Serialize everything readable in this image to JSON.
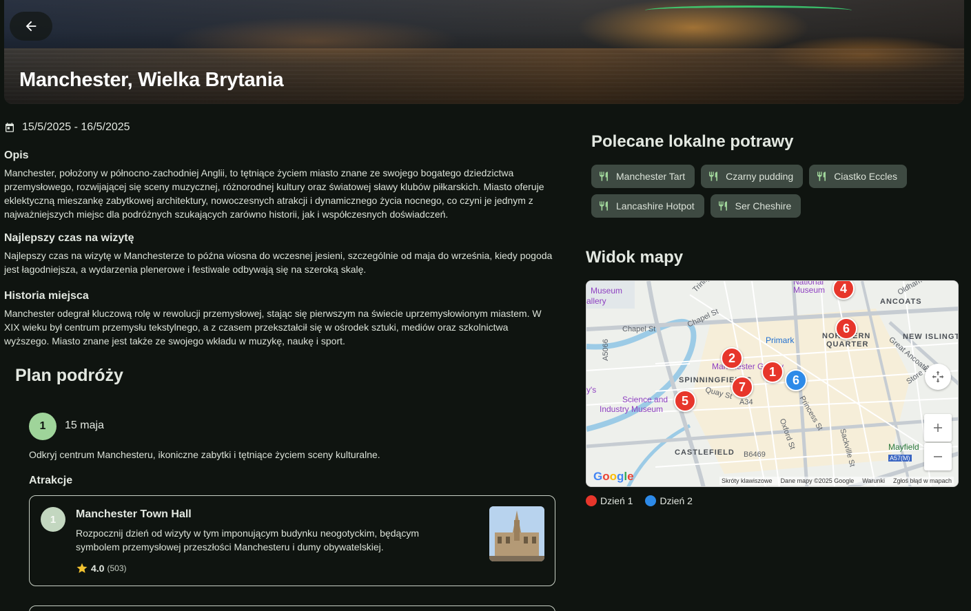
{
  "header": {
    "title": "Manchester, Wielka Brytania"
  },
  "dates": "15/5/2025 - 16/5/2025",
  "sections": {
    "opis": {
      "heading": "Opis",
      "text": "Manchester, położony w północno-zachodniej Anglii, to tętniące życiem miasto znane ze swojego bogatego dziedzictwa przemysłowego, rozwijającej się sceny muzycznej, różnorodnej kultury oraz światowej sławy klubów piłkarskich. Miasto oferuje eklektyczną mieszankę zabytkowej architektury, nowoczesnych atrakcji i dynamicznego życia nocnego, co czyni je jednym z najważniejszych miejsc dla podróżnych szukających zarówno historii, jak i współczesnych doświadczeń."
    },
    "best_time": {
      "heading": "Najlepszy czas na wizytę",
      "text": "Najlepszy czas na wizytę w Manchesterze to późna wiosna do wczesnej jesieni, szczególnie od maja do września, kiedy pogoda jest łagodniejsza, a wydarzenia plenerowe i festiwale odbywają się na szeroką skalę."
    },
    "history": {
      "heading": "Historia miejsca",
      "text": "Manchester odegrał kluczową rolę w rewolucji przemysłowej, stając się pierwszym na świecie uprzemysłowionym miastem. W XIX wieku był centrum przemysłu tekstylnego, a z czasem przekształcił się w ośrodek sztuki, mediów oraz szkolnictwa wyższego. Miasto znane jest także ze swojego wkładu w muzykę, naukę i sport."
    }
  },
  "plan": {
    "title": "Plan podróży",
    "day": {
      "number": "1",
      "label": "15 maja",
      "description": "Odkryj centrum Manchesteru, ikoniczne zabytki i tętniące życiem sceny kulturalne.",
      "attractions_heading": "Atrakcje",
      "attraction": {
        "number": "1",
        "name": "Manchester Town Hall",
        "description": "Rozpocznij dzień od wizyty w tym imponującym budynku neogotyckim, będącym symbolem przemysłowej przeszłości Manchesteru i dumy obywatelskiej.",
        "rating": "4.0",
        "reviews": "(503)"
      }
    }
  },
  "food": {
    "title": "Polecane lokalne potrawy",
    "items": [
      "Manchester Tart",
      "Czarny pudding",
      "Ciastko Eccles",
      "Lancashire Hotpot",
      "Ser Cheshire"
    ]
  },
  "map": {
    "title": "Widok mapy",
    "labels": {
      "museum_left": "Museum",
      "gallery_left": "allery",
      "national": "National",
      "museum_top": "Museum",
      "ancoats": "ANCOATS",
      "oldham": "Oldham",
      "trinity": "Trinity",
      "chapel_st": "Chapel St",
      "chapel_st2": "Chapel St",
      "a5066": "A5066",
      "primark": "Primark",
      "northern": "NORTHERN",
      "quarter": "QUARTER",
      "new_islington": "NEW ISLINGT",
      "great_ancoats": "Great Ancoats",
      "store_st": "Store St",
      "manchester_gallery": "Manchester Gallery",
      "spinningfields": "SPINNINGFIELDS",
      "quay_st": "Quay St",
      "a34": "A34",
      "ys": "y's",
      "science": "Science and",
      "industry": "Industry Museum",
      "oxford_st": "Oxford St",
      "princess_st": "Princess St",
      "sackville_st": "Sackville St",
      "castlefield": "CASTLEFIELD",
      "b6469": "B6469",
      "mayfield": "Mayfield",
      "a57m": "A57(M)"
    },
    "google": "Google",
    "attribution": [
      "Skróty klawiszowe",
      "Dane mapy ©2025 Google",
      "Warunki",
      "Zgłoś błąd w mapach"
    ],
    "pins": [
      {
        "label": "4",
        "day": 1
      },
      {
        "label": "6",
        "day": 1
      },
      {
        "label": "2",
        "day": 1
      },
      {
        "label": "1",
        "day": 1
      },
      {
        "label": "7",
        "day": 1
      },
      {
        "label": "5",
        "day": 1
      },
      {
        "label": "6",
        "day": 2
      }
    ],
    "colors": {
      "day1": "#e7362b",
      "day2": "#2d8ae8"
    }
  },
  "legend": [
    {
      "label": "Dzień 1",
      "color": "#e7362b"
    },
    {
      "label": "Dzień 2",
      "color": "#2d8ae8"
    }
  ]
}
